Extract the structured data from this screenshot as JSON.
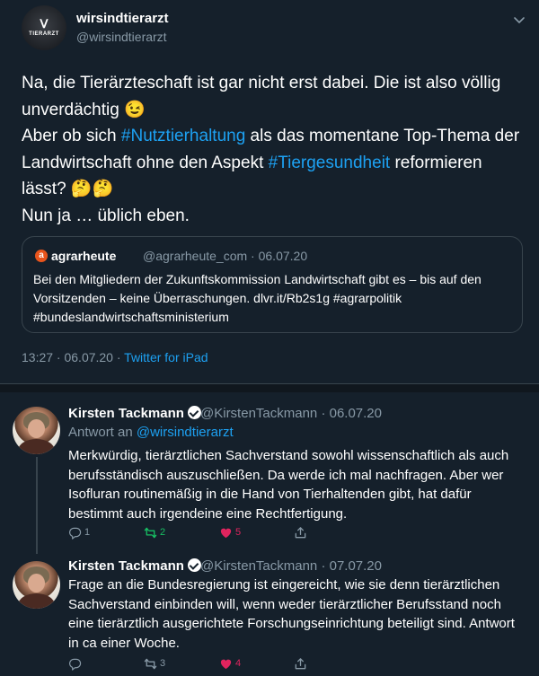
{
  "main_tweet": {
    "avatar_text": "TIERARZT",
    "display_name": "wirsindtierarzt",
    "handle": "@wirsindtierarzt",
    "text": {
      "l1": "Na, die Tierärzteschaft ist gar nicht erst dabei. Die ist also völlig",
      "l2": "unverdächtig 😉",
      "l3a": "Aber ob sich ",
      "l3b": "#Nutztierhaltung",
      "l3c": " als das momentane Top-Thema der",
      "l4a": "Landwirtschaft ohne den Aspekt ",
      "l4b": "#Tiergesundheit",
      "l4c": " reformieren",
      "l5": "lässt? 🤔🤔",
      "l6": "Nun ja … üblich eben."
    },
    "quote": {
      "logo_letter": "a",
      "name": "agrarheute",
      "meta": "@agrarheute_com · 06.07.20",
      "l1": "Bei den Mitgliedern der Zukunftskommission Landwirtschaft gibt es – bis auf den",
      "l2": "Vorsitzenden – keine Überraschungen. dlvr.it/Rb2s1g #agrarpolitik",
      "l3": "#bundeslandwirtschaftsministerium"
    },
    "timestamp": "13:27 · 06.07.20 · ",
    "source": "Twitter for iPad"
  },
  "replies": [
    {
      "name": "Kirsten Tackmann",
      "meta": "@KirstenTackmann · 06.07.20",
      "reply_to_prefix": "Antwort an ",
      "reply_to_mention": "@wirsindtierarzt",
      "lines": [
        "Merkwürdig,  tierärztlichen Sachverstand sowohl wissenschaftlich als auch",
        "berufsständisch auszuschließen. Da werde ich mal nachfragen. Aber wer",
        "Isofluran routinemäßig in die Hand von Tierhaltenden gibt, hat dafür",
        "bestimmt auch irgendeine eine Rechtfertigung."
      ],
      "replies": "1",
      "retweets": "2",
      "likes": "5"
    },
    {
      "name": "Kirsten Tackmann",
      "meta": "@KirstenTackmann · 07.07.20",
      "lines": [
        "Frage an die Bundesregierung ist eingereicht, wie sie denn tierärztlichen",
        "Sachverstand einbinden will, wenn weder tierärztlicher Berufsstand noch",
        "eine tierärztlich ausgerichtete Forschungseinrichtung beteiligt sind. Antwort",
        "in ca einer Woche."
      ],
      "replies": "",
      "retweets": "3",
      "likes": "4"
    }
  ],
  "colors": {
    "background": "#15202b",
    "link": "#1da1f2",
    "muted": "#8899a6",
    "retweet_active": "#17bf63",
    "like_active": "#e0245e"
  },
  "icons": [
    "chevron-down-icon",
    "verified-badge-icon",
    "reply-icon",
    "retweet-icon",
    "heart-icon",
    "share-icon"
  ]
}
